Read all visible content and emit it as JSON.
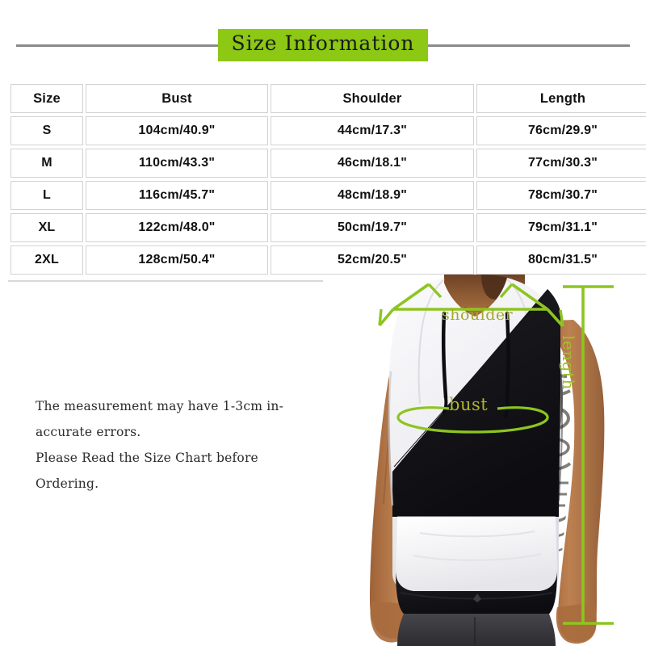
{
  "header": {
    "title": "Size Information",
    "banner_color": "#8cc814",
    "rule_color": "#8a8a8a"
  },
  "size_table": {
    "columns": [
      "Size",
      "Bust",
      "Shoulder",
      "Length"
    ],
    "rows": [
      {
        "size": "S",
        "bust": "104cm/40.9\"",
        "shoulder": "44cm/17.3\"",
        "length": "76cm/29.9\""
      },
      {
        "size": "M",
        "bust": "110cm/43.3\"",
        "shoulder": "46cm/18.1\"",
        "length": "77cm/30.3\""
      },
      {
        "size": "L",
        "bust": "116cm/45.7\"",
        "shoulder": "48cm/18.9\"",
        "length": "78cm/30.7\""
      },
      {
        "size": "XL",
        "bust": "122cm/48.0\"",
        "shoulder": "50cm/19.7\"",
        "length": "79cm/31.1\""
      },
      {
        "size": "2XL",
        "bust": "128cm/50.4\"",
        "shoulder": "52cm/20.5\"",
        "length": "80cm/31.5\""
      }
    ]
  },
  "notes": {
    "line1": "The measurement may have 1-3cm in-",
    "line2": "accurate errors.",
    "line3": "Please Read the Size Chart before",
    "line4": "Ordering."
  },
  "measurement_annotations": {
    "shoulder_label": "shoulder",
    "bust_label": "bust",
    "length_label": "length",
    "line_color": "#8dc520",
    "text_color": "#a2a82c"
  },
  "product_photo": {
    "description": "male-model-wearing-sleeveless-hooded-tank-top",
    "garment_colors": {
      "white": "#f4f4f6",
      "black": "#15151a",
      "skin": "#b5794a",
      "shorts": "#3a3a3e"
    }
  }
}
